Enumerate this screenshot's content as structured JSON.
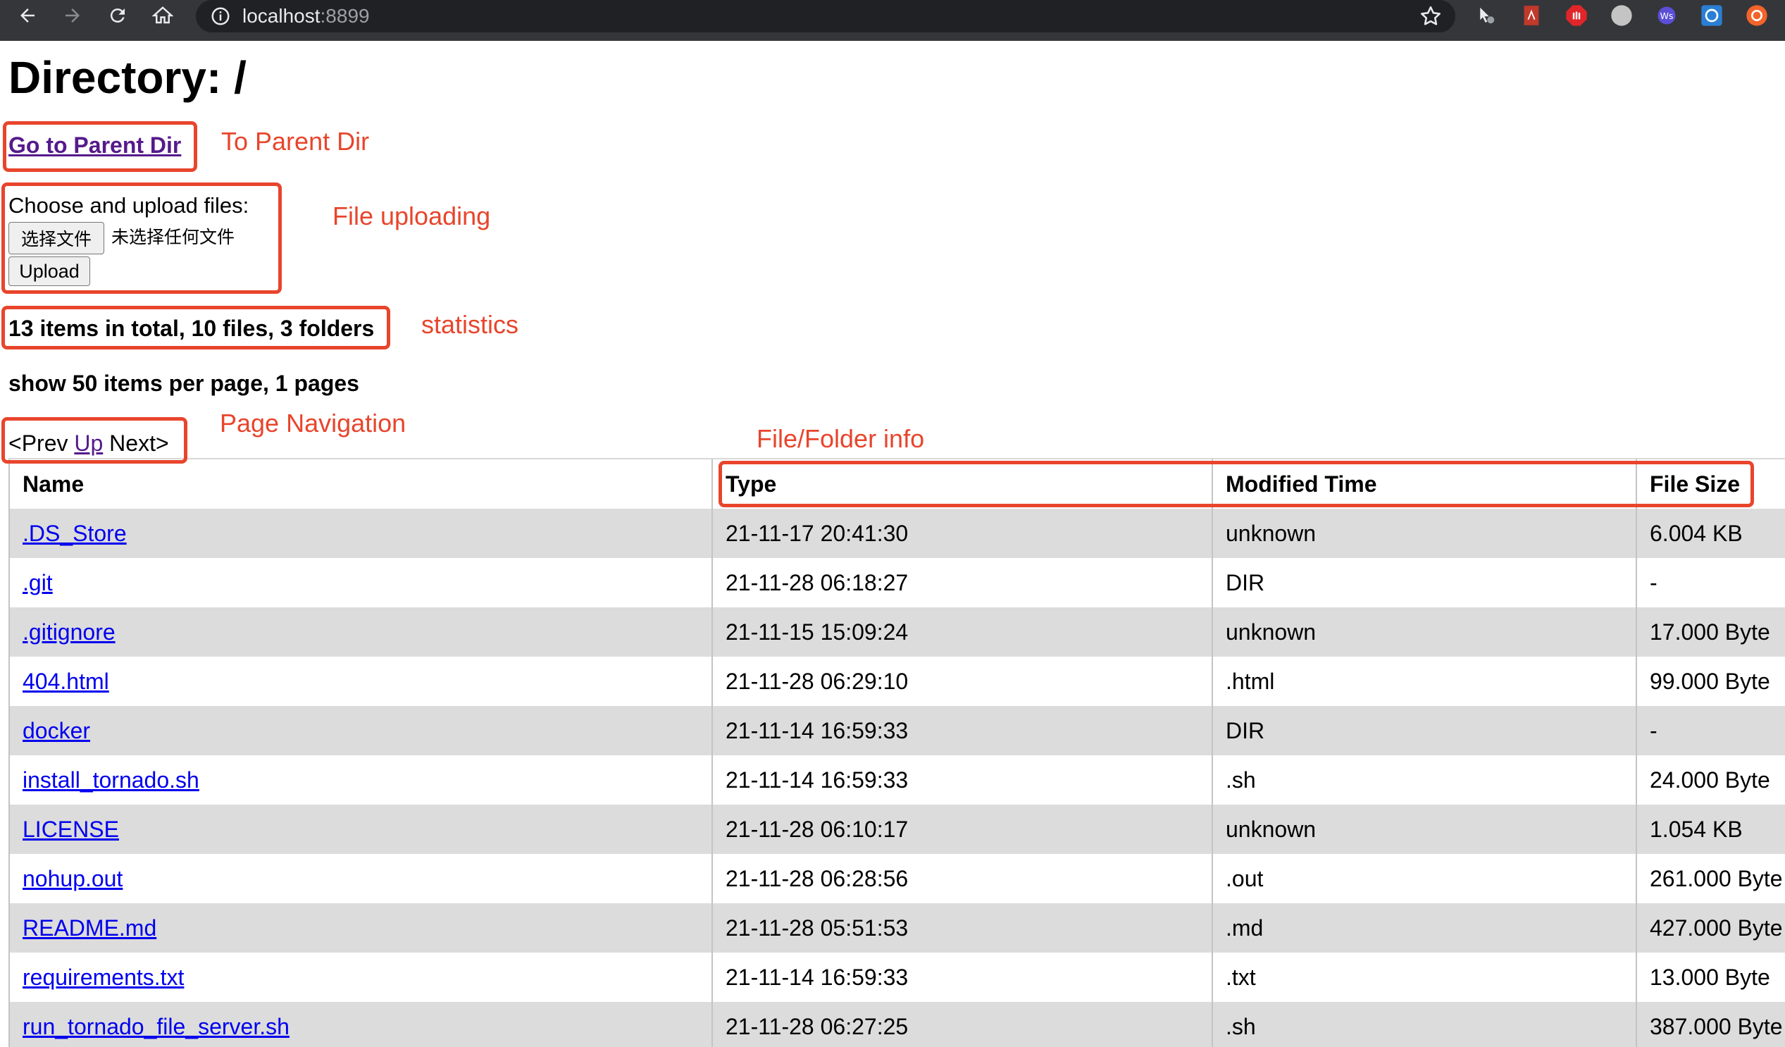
{
  "browser": {
    "url_host": "localhost",
    "url_port": ":8899",
    "nav_icons": [
      "back-icon",
      "forward-icon",
      "reload-icon",
      "home-icon"
    ],
    "extension_icons": [
      "extension-cursor-icon",
      "extension-pdf-icon",
      "extension-stop-icon",
      "extension-grey-circle-icon",
      "extension-ws-icon",
      "extension-translate-icon",
      "extension-orange-icon"
    ]
  },
  "page": {
    "title": "Directory: /",
    "parent_link": "Go to Parent Dir",
    "upload": {
      "label": "Choose and upload files:",
      "choose_button": "选择文件",
      "no_file_text": "未选择任何文件",
      "upload_button": "Upload"
    },
    "stats": "13 items in total, 10 files, 3 folders",
    "per_page": "show 50 items per page, 1 pages",
    "pager": {
      "prev": "<Prev",
      "up": "Up",
      "next": "Next>"
    }
  },
  "table": {
    "headers": {
      "name": "Name",
      "type": "Type",
      "modified": "Modified Time",
      "size": "File Size"
    },
    "rows": [
      {
        "name": ".DS_Store",
        "type": "21-11-17 20:41:30",
        "modified": "unknown",
        "size": "6.004 KB"
      },
      {
        "name": ".git",
        "type": "21-11-28 06:18:27",
        "modified": "DIR",
        "size": "-"
      },
      {
        "name": ".gitignore",
        "type": "21-11-15 15:09:24",
        "modified": "unknown",
        "size": "17.000 Byte"
      },
      {
        "name": "404.html",
        "type": "21-11-28 06:29:10",
        "modified": ".html",
        "size": "99.000 Byte"
      },
      {
        "name": "docker",
        "type": "21-11-14 16:59:33",
        "modified": "DIR",
        "size": "-"
      },
      {
        "name": "install_tornado.sh",
        "type": "21-11-14 16:59:33",
        "modified": ".sh",
        "size": "24.000 Byte"
      },
      {
        "name": "LICENSE",
        "type": "21-11-28 06:10:17",
        "modified": "unknown",
        "size": "1.054 KB"
      },
      {
        "name": "nohup.out",
        "type": "21-11-28 06:28:56",
        "modified": ".out",
        "size": "261.000 Byte"
      },
      {
        "name": "README.md",
        "type": "21-11-28 05:51:53",
        "modified": ".md",
        "size": "427.000 Byte"
      },
      {
        "name": "requirements.txt",
        "type": "21-11-14 16:59:33",
        "modified": ".txt",
        "size": "13.000 Byte"
      },
      {
        "name": "run_tornado_file_server.sh",
        "type": "21-11-28 06:27:25",
        "modified": ".sh",
        "size": "387.000 Byte"
      }
    ]
  },
  "annotations": {
    "parent_dir": "To Parent Dir",
    "file_uploading": "File uploading",
    "statistics": "statistics",
    "page_navigation": "Page Navigation",
    "file_folder_info": "File/Folder info",
    "color": "#e8452c"
  }
}
